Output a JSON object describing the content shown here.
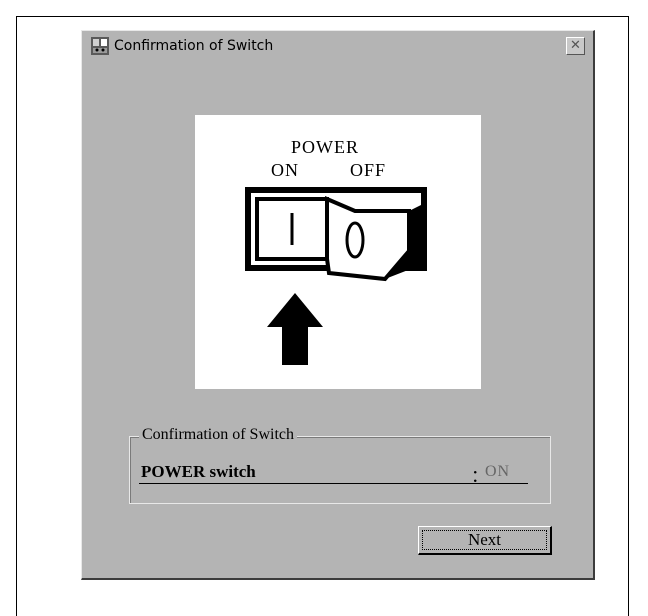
{
  "window": {
    "title": "Confirmation of Switch",
    "close_icon": "close-icon",
    "app_icon": "app-icon"
  },
  "illustration": {
    "power_label": "POWER",
    "on_label": "ON",
    "off_label": "OFF",
    "on_symbol": "I",
    "off_symbol": "O",
    "arrow_icon": "up-arrow-icon"
  },
  "group": {
    "legend": "Confirmation of Switch",
    "row_label": "POWER switch",
    "row_colon": "：",
    "row_value": "ON"
  },
  "buttons": {
    "next_label": "Next"
  },
  "colors": {
    "window_bg": "#b4b4b4",
    "value_text": "#666666"
  }
}
